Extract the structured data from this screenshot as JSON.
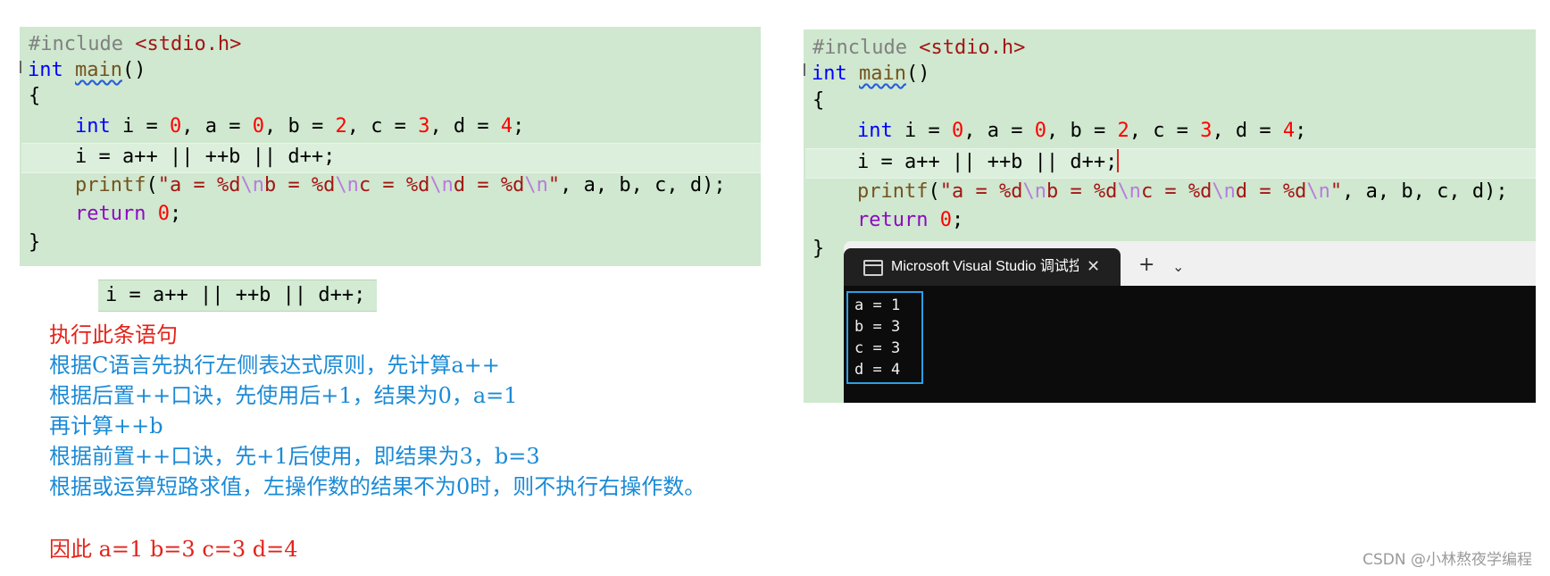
{
  "code": {
    "include_directive": "#include",
    "include_header": "<stdio.h>",
    "kw_int": "int",
    "main_name": "main",
    "main_parens": "()",
    "open_brace": "{",
    "close_brace": "}",
    "decl_rest": " i = ",
    "n0": "0",
    "sep_a": ", a = ",
    "sep_b": ", b = ",
    "n2": "2",
    "sep_c": ", c = ",
    "n3": "3",
    "sep_d": ", d = ",
    "n4": "4",
    "semi": ";",
    "expr_line": "i = a++ || ++b || d++;",
    "printf_name": "printf",
    "paren_open": "(",
    "fmt_q1": "\"a = %d",
    "esc_n": "\\n",
    "fmt_b": "b = %d",
    "fmt_c": "c = %d",
    "fmt_d": "d = %d",
    "fmt_q2": "\"",
    "printf_args": ", a, b, c, d);",
    "kw_return": "return",
    "space": " "
  },
  "snippet": "i = a++ || ++b || d++;",
  "notes": {
    "line1": "执行此条语句",
    "line2": "根据C语言先执行左侧表达式原则，先计算a++",
    "line3": "根据后置++口诀，先使用后+1，结果为0，a=1",
    "line4": "再计算++b",
    "line5": "根据前置++口诀，先+1后使用，即结果为3，b=3",
    "line6": "根据或运算短路求值，左操作数的结果不为0时，则不执行右操作数。",
    "conclusion": "因此 a=1 b=3 c=3 d=4"
  },
  "terminal": {
    "tab_title": "Microsoft Visual Studio 调试控制台",
    "close_glyph": "✕",
    "plus_glyph": "+",
    "chevron_glyph": "⌄",
    "output": [
      "a = 1",
      "b = 3",
      "c = 3",
      "d = 4"
    ]
  },
  "watermark": "CSDN @小林熬夜学编程",
  "colors": {
    "code_bg": "#cfe8cf",
    "keyword": "#0000ff",
    "number": "#ff0000",
    "string": "#a31515",
    "note_red": "#e2231a",
    "note_blue": "#1a8ad6",
    "terminal_bg": "#0c0c0c",
    "output_box": "#2aa0e6"
  }
}
